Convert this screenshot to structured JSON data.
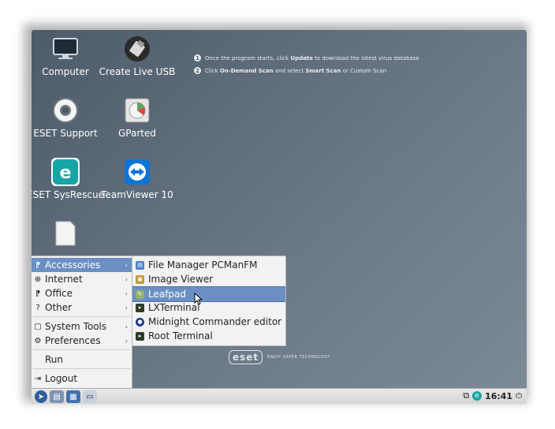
{
  "instructions": [
    {
      "num": "1",
      "pre": "Once the program starts, click ",
      "bold": "Update",
      "post": " to download the latest virus database",
      "bold2": "",
      "post2": ""
    },
    {
      "num": "2",
      "pre": "Click ",
      "bold": "On-Demand Scan",
      "post": " and select ",
      "bold2": "Smart Scan",
      "post2": " or Custom Scan"
    }
  ],
  "desktop_icons": [
    {
      "name": "computer",
      "label": "Computer",
      "icon": "monitor-icon"
    },
    {
      "name": "create-live-usb",
      "label": "Create Live USB",
      "icon": "usb-icon"
    },
    {
      "name": "eset-support",
      "label": "ESET Support",
      "icon": "lifebuoy-icon"
    },
    {
      "name": "gparted",
      "label": "GParted",
      "icon": "gparted-icon"
    },
    {
      "name": "eset-sysrescue",
      "label": "ESET SysRescue",
      "icon": "eset-icon"
    },
    {
      "name": "teamviewer",
      "label": "TeamViewer 10",
      "icon": "teamviewer-icon"
    },
    {
      "name": "document",
      "label": "",
      "icon": "document-icon"
    }
  ],
  "main_menu": {
    "items": [
      {
        "label": "Accessories",
        "icon": "accessories-icon",
        "has_submenu": true,
        "active": true
      },
      {
        "label": "Internet",
        "icon": "globe-icon",
        "has_submenu": true
      },
      {
        "label": "Office",
        "icon": "office-icon",
        "has_submenu": true
      },
      {
        "label": "Other",
        "icon": "question-icon",
        "has_submenu": true
      },
      {
        "label": "System Tools",
        "icon": "system-tools-icon",
        "has_submenu": true
      },
      {
        "label": "Preferences",
        "icon": "gear-icon",
        "has_submenu": true
      },
      {
        "label": "Run",
        "icon": "",
        "has_submenu": false
      },
      {
        "label": "Logout",
        "icon": "logout-icon",
        "has_submenu": false
      }
    ]
  },
  "submenu": {
    "items": [
      {
        "label": "File Manager PCManFM",
        "icon": "file-manager-icon",
        "color": "#4b83c7"
      },
      {
        "label": "Image Viewer",
        "icon": "image-viewer-icon",
        "color": "#c49a3a"
      },
      {
        "label": "Leafpad",
        "icon": "leafpad-icon",
        "color": "#8fb56a",
        "active": true
      },
      {
        "label": "LXTerminal",
        "icon": "terminal-icon",
        "color": "#2e3b2a"
      },
      {
        "label": "Midnight Commander editor",
        "icon": "mc-icon",
        "color": "#1b3c8c"
      },
      {
        "label": "Root Terminal",
        "icon": "root-terminal-icon",
        "color": "#2e3b2a"
      }
    ]
  },
  "brand": {
    "logo": "eset",
    "tagline": "ENJOY SAFER TECHNOLOGY"
  },
  "taskbar": {
    "clock": "16:41"
  },
  "colors": {
    "desktop": "#5d6b7a",
    "menu_highlight": "#6b8fc2",
    "menu_bg": "#f2f2f2"
  }
}
